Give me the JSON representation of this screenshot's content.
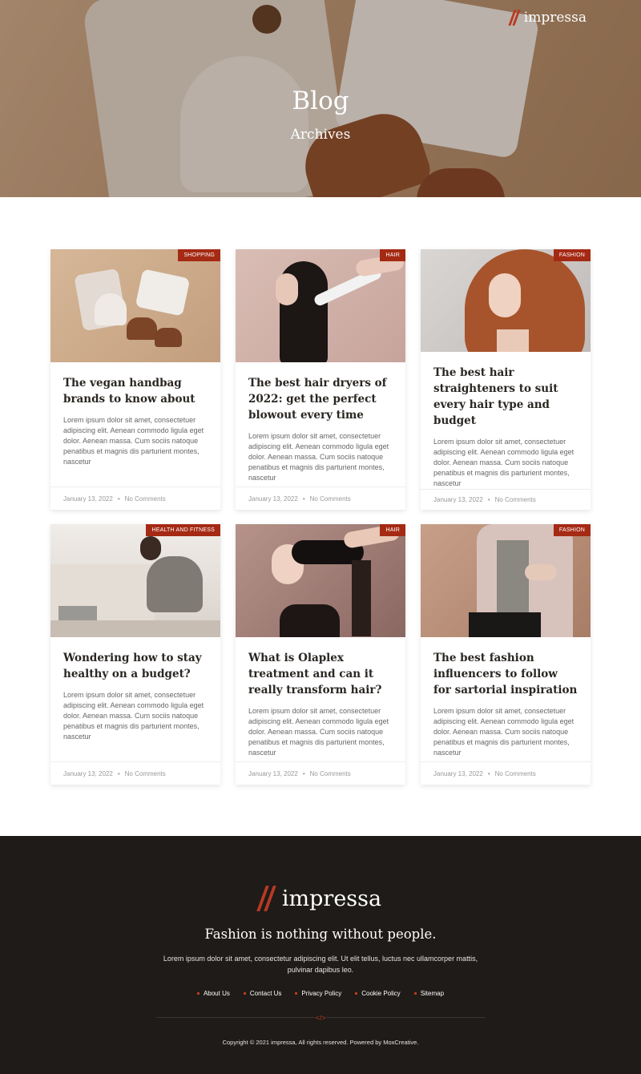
{
  "header": {
    "logo_text": "impressa",
    "title": "Blog",
    "subtitle": "Archives"
  },
  "posts": [
    {
      "category": "Shopping",
      "title": "The vegan handbag brands to know about",
      "excerpt": "Lorem ipsum dolor sit amet, consectetuer adipiscing elit. Aenean commodo ligula eget dolor. Aenean massa. Cum sociis natoque penatibus et magnis dis parturient montes, nascetur",
      "date": "January 13, 2022",
      "comments": "No Comments"
    },
    {
      "category": "Hair",
      "title": "The best hair dryers of 2022: get the perfect blowout every time",
      "excerpt": "Lorem ipsum dolor sit amet, consectetuer adipiscing elit. Aenean commodo ligula eget dolor. Aenean massa. Cum sociis natoque penatibus et magnis dis parturient montes, nascetur",
      "date": "January 13, 2022",
      "comments": "No Comments"
    },
    {
      "category": "Fashion",
      "title": "The best hair straighteners to suit every hair type and budget",
      "excerpt": "Lorem ipsum dolor sit amet, consectetuer adipiscing elit. Aenean commodo ligula eget dolor. Aenean massa. Cum sociis natoque penatibus et magnis dis parturient montes, nascetur",
      "date": "January 13, 2022",
      "comments": "No Comments"
    },
    {
      "category": "Health and Fitness",
      "title": "Wondering how to stay healthy on a budget?",
      "excerpt": "Lorem ipsum dolor sit amet, consectetuer adipiscing elit. Aenean commodo ligula eget dolor. Aenean massa. Cum sociis natoque penatibus et magnis dis parturient montes, nascetur",
      "date": "January 13, 2022",
      "comments": "No Comments"
    },
    {
      "category": "Hair",
      "title": "What is Olaplex treatment and can it really transform hair?",
      "excerpt": "Lorem ipsum dolor sit amet, consectetuer adipiscing elit. Aenean commodo ligula eget dolor. Aenean massa. Cum sociis natoque penatibus et magnis dis parturient montes, nascetur",
      "date": "January 13, 2022",
      "comments": "No Comments"
    },
    {
      "category": "Fashion",
      "title": "The best fashion influencers to follow for sartorial inspiration",
      "excerpt": "Lorem ipsum dolor sit amet, consectetuer adipiscing elit. Aenean commodo ligula eget dolor. Aenean massa. Cum sociis natoque penatibus et magnis dis parturient montes, nascetur",
      "date": "January 13, 2022",
      "comments": "No Comments"
    }
  ],
  "footer": {
    "logo_text": "impressa",
    "tagline": "Fashion is nothing without people.",
    "description": "Lorem ipsum dolor sit amet, consectetur adipiscing elit. Ut elit tellus, luctus nec ullamcorper mattis, pulvinar dapibus leo.",
    "links": [
      "About Us",
      "Contact Us",
      "Privacy Policy",
      "Cookie Policy",
      "Sitemap"
    ],
    "divider_icon": "</>",
    "copyright": "Copyright © 2021 impressa, All rights reserved. Powered by MoxCreative."
  },
  "colors": {
    "accent": "#a52a14",
    "footer_bg": "#1e1b18"
  }
}
